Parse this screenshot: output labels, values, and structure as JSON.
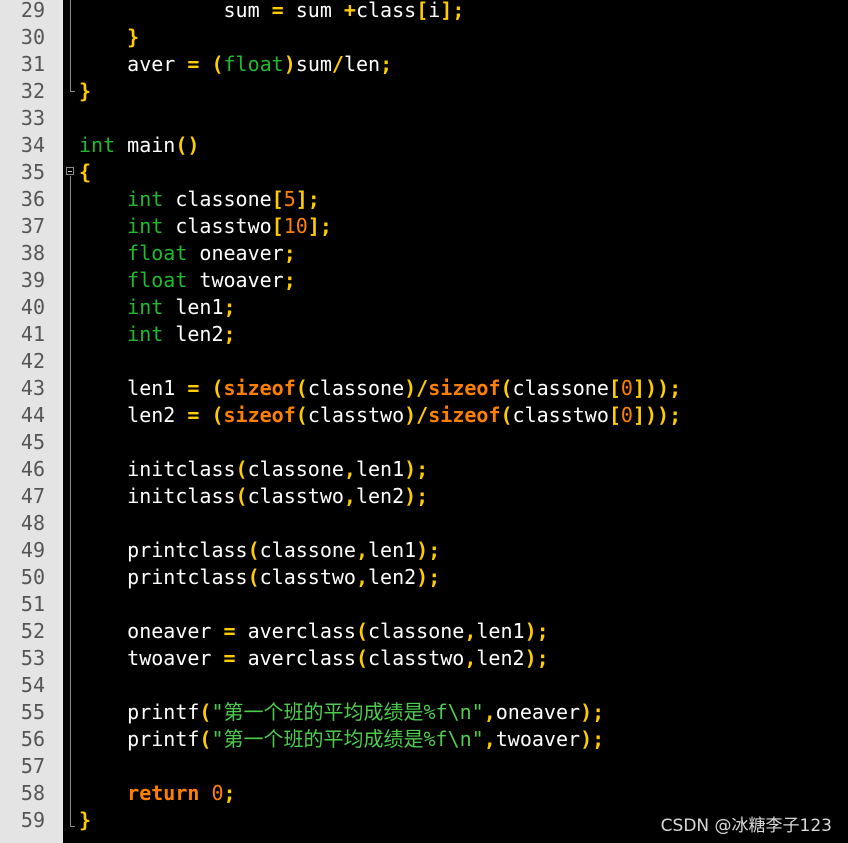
{
  "editor": {
    "colors": {
      "background": "#000000",
      "gutter": "#e4e4e4",
      "line_number": "#555555",
      "keyword_type": "#1fba2e",
      "keyword_bold": "#ff8000",
      "number": "#ff8000",
      "operator": "#ffcc00",
      "string": "#4dcc4d",
      "identifier": "#ffffff"
    },
    "lines": [
      {
        "n": "29",
        "tokens": [
          {
            "t": "            sum ",
            "k": "id"
          },
          {
            "t": "=",
            "k": "op"
          },
          {
            "t": " sum ",
            "k": "id"
          },
          {
            "t": "+",
            "k": "op"
          },
          {
            "t": "class",
            "k": "id"
          },
          {
            "t": "[",
            "k": "op"
          },
          {
            "t": "i",
            "k": "id"
          },
          {
            "t": "];",
            "k": "op"
          }
        ]
      },
      {
        "n": "30",
        "tokens": [
          {
            "t": "    ",
            "k": "id"
          },
          {
            "t": "}",
            "k": "op"
          }
        ]
      },
      {
        "n": "31",
        "tokens": [
          {
            "t": "    aver ",
            "k": "id"
          },
          {
            "t": "=",
            "k": "op"
          },
          {
            "t": " ",
            "k": "id"
          },
          {
            "t": "(",
            "k": "op"
          },
          {
            "t": "float",
            "k": "kw"
          },
          {
            "t": ")",
            "k": "op"
          },
          {
            "t": "sum",
            "k": "id"
          },
          {
            "t": "/",
            "k": "op"
          },
          {
            "t": "len",
            "k": "id"
          },
          {
            "t": ";",
            "k": "op"
          }
        ]
      },
      {
        "n": "32",
        "tokens": [
          {
            "t": "}",
            "k": "op"
          }
        ]
      },
      {
        "n": "33",
        "tokens": []
      },
      {
        "n": "34",
        "tokens": [
          {
            "t": "int",
            "k": "kw"
          },
          {
            "t": " main",
            "k": "id"
          },
          {
            "t": "()",
            "k": "op"
          }
        ]
      },
      {
        "n": "35",
        "tokens": [
          {
            "t": "{",
            "k": "op"
          }
        ]
      },
      {
        "n": "36",
        "tokens": [
          {
            "t": "    ",
            "k": "id"
          },
          {
            "t": "int",
            "k": "kw"
          },
          {
            "t": " classone",
            "k": "id"
          },
          {
            "t": "[",
            "k": "op"
          },
          {
            "t": "5",
            "k": "num"
          },
          {
            "t": "];",
            "k": "op"
          }
        ]
      },
      {
        "n": "37",
        "tokens": [
          {
            "t": "    ",
            "k": "id"
          },
          {
            "t": "int",
            "k": "kw"
          },
          {
            "t": " classtwo",
            "k": "id"
          },
          {
            "t": "[",
            "k": "op"
          },
          {
            "t": "10",
            "k": "num"
          },
          {
            "t": "];",
            "k": "op"
          }
        ]
      },
      {
        "n": "38",
        "tokens": [
          {
            "t": "    ",
            "k": "id"
          },
          {
            "t": "float",
            "k": "kw"
          },
          {
            "t": " oneaver",
            "k": "id"
          },
          {
            "t": ";",
            "k": "op"
          }
        ]
      },
      {
        "n": "39",
        "tokens": [
          {
            "t": "    ",
            "k": "id"
          },
          {
            "t": "float",
            "k": "kw"
          },
          {
            "t": " twoaver",
            "k": "id"
          },
          {
            "t": ";",
            "k": "op"
          }
        ]
      },
      {
        "n": "40",
        "tokens": [
          {
            "t": "    ",
            "k": "id"
          },
          {
            "t": "int",
            "k": "kw"
          },
          {
            "t": " len1",
            "k": "id"
          },
          {
            "t": ";",
            "k": "op"
          }
        ]
      },
      {
        "n": "41",
        "tokens": [
          {
            "t": "    ",
            "k": "id"
          },
          {
            "t": "int",
            "k": "kw"
          },
          {
            "t": " len2",
            "k": "id"
          },
          {
            "t": ";",
            "k": "op"
          }
        ]
      },
      {
        "n": "42",
        "tokens": []
      },
      {
        "n": "43",
        "tokens": [
          {
            "t": "    len1 ",
            "k": "id"
          },
          {
            "t": "=",
            "k": "op"
          },
          {
            "t": " ",
            "k": "id"
          },
          {
            "t": "(",
            "k": "op"
          },
          {
            "t": "sizeof",
            "k": "kwb"
          },
          {
            "t": "(",
            "k": "op"
          },
          {
            "t": "classone",
            "k": "id"
          },
          {
            "t": ")/",
            "k": "op"
          },
          {
            "t": "sizeof",
            "k": "kwb"
          },
          {
            "t": "(",
            "k": "op"
          },
          {
            "t": "classone",
            "k": "id"
          },
          {
            "t": "[",
            "k": "op"
          },
          {
            "t": "0",
            "k": "num"
          },
          {
            "t": "]));",
            "k": "op"
          }
        ]
      },
      {
        "n": "44",
        "tokens": [
          {
            "t": "    len2 ",
            "k": "id"
          },
          {
            "t": "=",
            "k": "op"
          },
          {
            "t": " ",
            "k": "id"
          },
          {
            "t": "(",
            "k": "op"
          },
          {
            "t": "sizeof",
            "k": "kwb"
          },
          {
            "t": "(",
            "k": "op"
          },
          {
            "t": "classtwo",
            "k": "id"
          },
          {
            "t": ")/",
            "k": "op"
          },
          {
            "t": "sizeof",
            "k": "kwb"
          },
          {
            "t": "(",
            "k": "op"
          },
          {
            "t": "classtwo",
            "k": "id"
          },
          {
            "t": "[",
            "k": "op"
          },
          {
            "t": "0",
            "k": "num"
          },
          {
            "t": "]));",
            "k": "op"
          }
        ]
      },
      {
        "n": "45",
        "tokens": []
      },
      {
        "n": "46",
        "tokens": [
          {
            "t": "    initclass",
            "k": "id"
          },
          {
            "t": "(",
            "k": "op"
          },
          {
            "t": "classone",
            "k": "id"
          },
          {
            "t": ",",
            "k": "op"
          },
          {
            "t": "len1",
            "k": "id"
          },
          {
            "t": ");",
            "k": "op"
          }
        ]
      },
      {
        "n": "47",
        "tokens": [
          {
            "t": "    initclass",
            "k": "id"
          },
          {
            "t": "(",
            "k": "op"
          },
          {
            "t": "classtwo",
            "k": "id"
          },
          {
            "t": ",",
            "k": "op"
          },
          {
            "t": "len2",
            "k": "id"
          },
          {
            "t": ");",
            "k": "op"
          }
        ]
      },
      {
        "n": "48",
        "tokens": []
      },
      {
        "n": "49",
        "tokens": [
          {
            "t": "    printclass",
            "k": "id"
          },
          {
            "t": "(",
            "k": "op"
          },
          {
            "t": "classone",
            "k": "id"
          },
          {
            "t": ",",
            "k": "op"
          },
          {
            "t": "len1",
            "k": "id"
          },
          {
            "t": ");",
            "k": "op"
          }
        ]
      },
      {
        "n": "50",
        "tokens": [
          {
            "t": "    printclass",
            "k": "id"
          },
          {
            "t": "(",
            "k": "op"
          },
          {
            "t": "classtwo",
            "k": "id"
          },
          {
            "t": ",",
            "k": "op"
          },
          {
            "t": "len2",
            "k": "id"
          },
          {
            "t": ");",
            "k": "op"
          }
        ]
      },
      {
        "n": "51",
        "tokens": []
      },
      {
        "n": "52",
        "tokens": [
          {
            "t": "    oneaver ",
            "k": "id"
          },
          {
            "t": "=",
            "k": "op"
          },
          {
            "t": " averclass",
            "k": "id"
          },
          {
            "t": "(",
            "k": "op"
          },
          {
            "t": "classone",
            "k": "id"
          },
          {
            "t": ",",
            "k": "op"
          },
          {
            "t": "len1",
            "k": "id"
          },
          {
            "t": ");",
            "k": "op"
          }
        ]
      },
      {
        "n": "53",
        "tokens": [
          {
            "t": "    twoaver ",
            "k": "id"
          },
          {
            "t": "=",
            "k": "op"
          },
          {
            "t": " averclass",
            "k": "id"
          },
          {
            "t": "(",
            "k": "op"
          },
          {
            "t": "classtwo",
            "k": "id"
          },
          {
            "t": ",",
            "k": "op"
          },
          {
            "t": "len2",
            "k": "id"
          },
          {
            "t": ");",
            "k": "op"
          }
        ]
      },
      {
        "n": "54",
        "tokens": []
      },
      {
        "n": "55",
        "tokens": [
          {
            "t": "    printf",
            "k": "id"
          },
          {
            "t": "(",
            "k": "op"
          },
          {
            "t": "\"第一个班的平均成绩是%f\\n\"",
            "k": "str"
          },
          {
            "t": ",",
            "k": "op"
          },
          {
            "t": "oneaver",
            "k": "id"
          },
          {
            "t": ");",
            "k": "op"
          }
        ]
      },
      {
        "n": "56",
        "tokens": [
          {
            "t": "    printf",
            "k": "id"
          },
          {
            "t": "(",
            "k": "op"
          },
          {
            "t": "\"第一个班的平均成绩是%f\\n\"",
            "k": "str"
          },
          {
            "t": ",",
            "k": "op"
          },
          {
            "t": "twoaver",
            "k": "id"
          },
          {
            "t": ");",
            "k": "op"
          }
        ]
      },
      {
        "n": "57",
        "tokens": []
      },
      {
        "n": "58",
        "tokens": [
          {
            "t": "    ",
            "k": "id"
          },
          {
            "t": "return",
            "k": "kwb"
          },
          {
            "t": " ",
            "k": "id"
          },
          {
            "t": "0",
            "k": "num"
          },
          {
            "t": ";",
            "k": "op"
          }
        ]
      },
      {
        "n": "59",
        "tokens": [
          {
            "t": "}",
            "k": "op"
          }
        ]
      }
    ]
  },
  "watermark": "CSDN @冰糖李子123"
}
